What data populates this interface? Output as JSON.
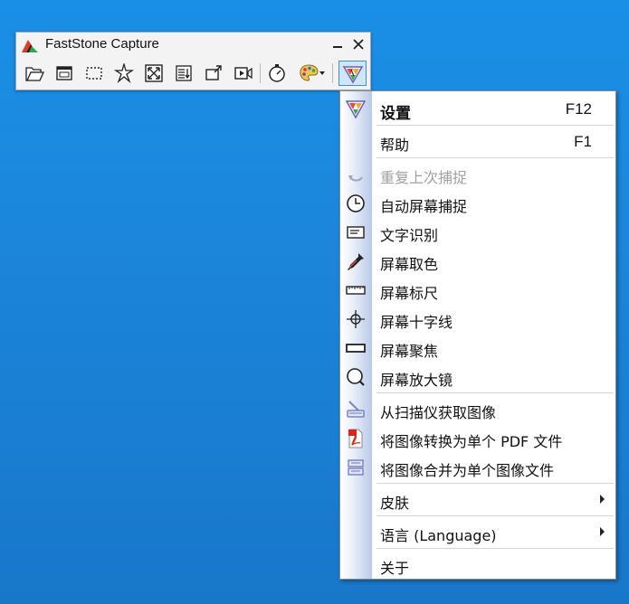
{
  "app": {
    "title": "FastStone Capture"
  },
  "toolbar": {
    "tools": [
      {
        "name": "open-file-icon"
      },
      {
        "name": "capture-window-icon"
      },
      {
        "name": "capture-rectangle-icon"
      },
      {
        "name": "capture-freehand-icon"
      },
      {
        "name": "capture-fullscreen-icon"
      },
      {
        "name": "capture-scrolling-icon"
      },
      {
        "name": "capture-fixed-region-icon"
      },
      {
        "name": "screen-recorder-icon"
      },
      {
        "name": "delay-timer-icon"
      },
      {
        "name": "output-destination-icon"
      },
      {
        "name": "menu-icon"
      }
    ]
  },
  "menu": {
    "items": [
      {
        "label": "设置",
        "shortcut": "F12",
        "icon": "settings-icon",
        "bold": true
      },
      {
        "label": "帮助",
        "shortcut": "F1",
        "icon": ""
      },
      {
        "label": "重复上次捕捉",
        "icon": "repeat-icon",
        "disabled": true
      },
      {
        "label": "自动屏幕捕捉",
        "icon": "clock-icon"
      },
      {
        "label": "文字识别",
        "icon": "ocr-icon"
      },
      {
        "label": "屏幕取色",
        "icon": "eyedropper-icon"
      },
      {
        "label": "屏幕标尺",
        "icon": "ruler-icon"
      },
      {
        "label": "屏幕十字线",
        "icon": "crosshair-icon"
      },
      {
        "label": "屏幕聚焦",
        "icon": "focus-icon"
      },
      {
        "label": "屏幕放大镜",
        "icon": "magnifier-icon"
      },
      {
        "label": "从扫描仪获取图像",
        "icon": "scanner-icon"
      },
      {
        "label": "将图像转换为单个 PDF 文件",
        "icon": "pdf-icon"
      },
      {
        "label": "将图像合并为单个图像文件",
        "icon": "combine-icon"
      },
      {
        "label": "皮肤",
        "submenu": true
      },
      {
        "label": "语言 (Language)",
        "submenu": true
      },
      {
        "label": "关于"
      }
    ]
  }
}
